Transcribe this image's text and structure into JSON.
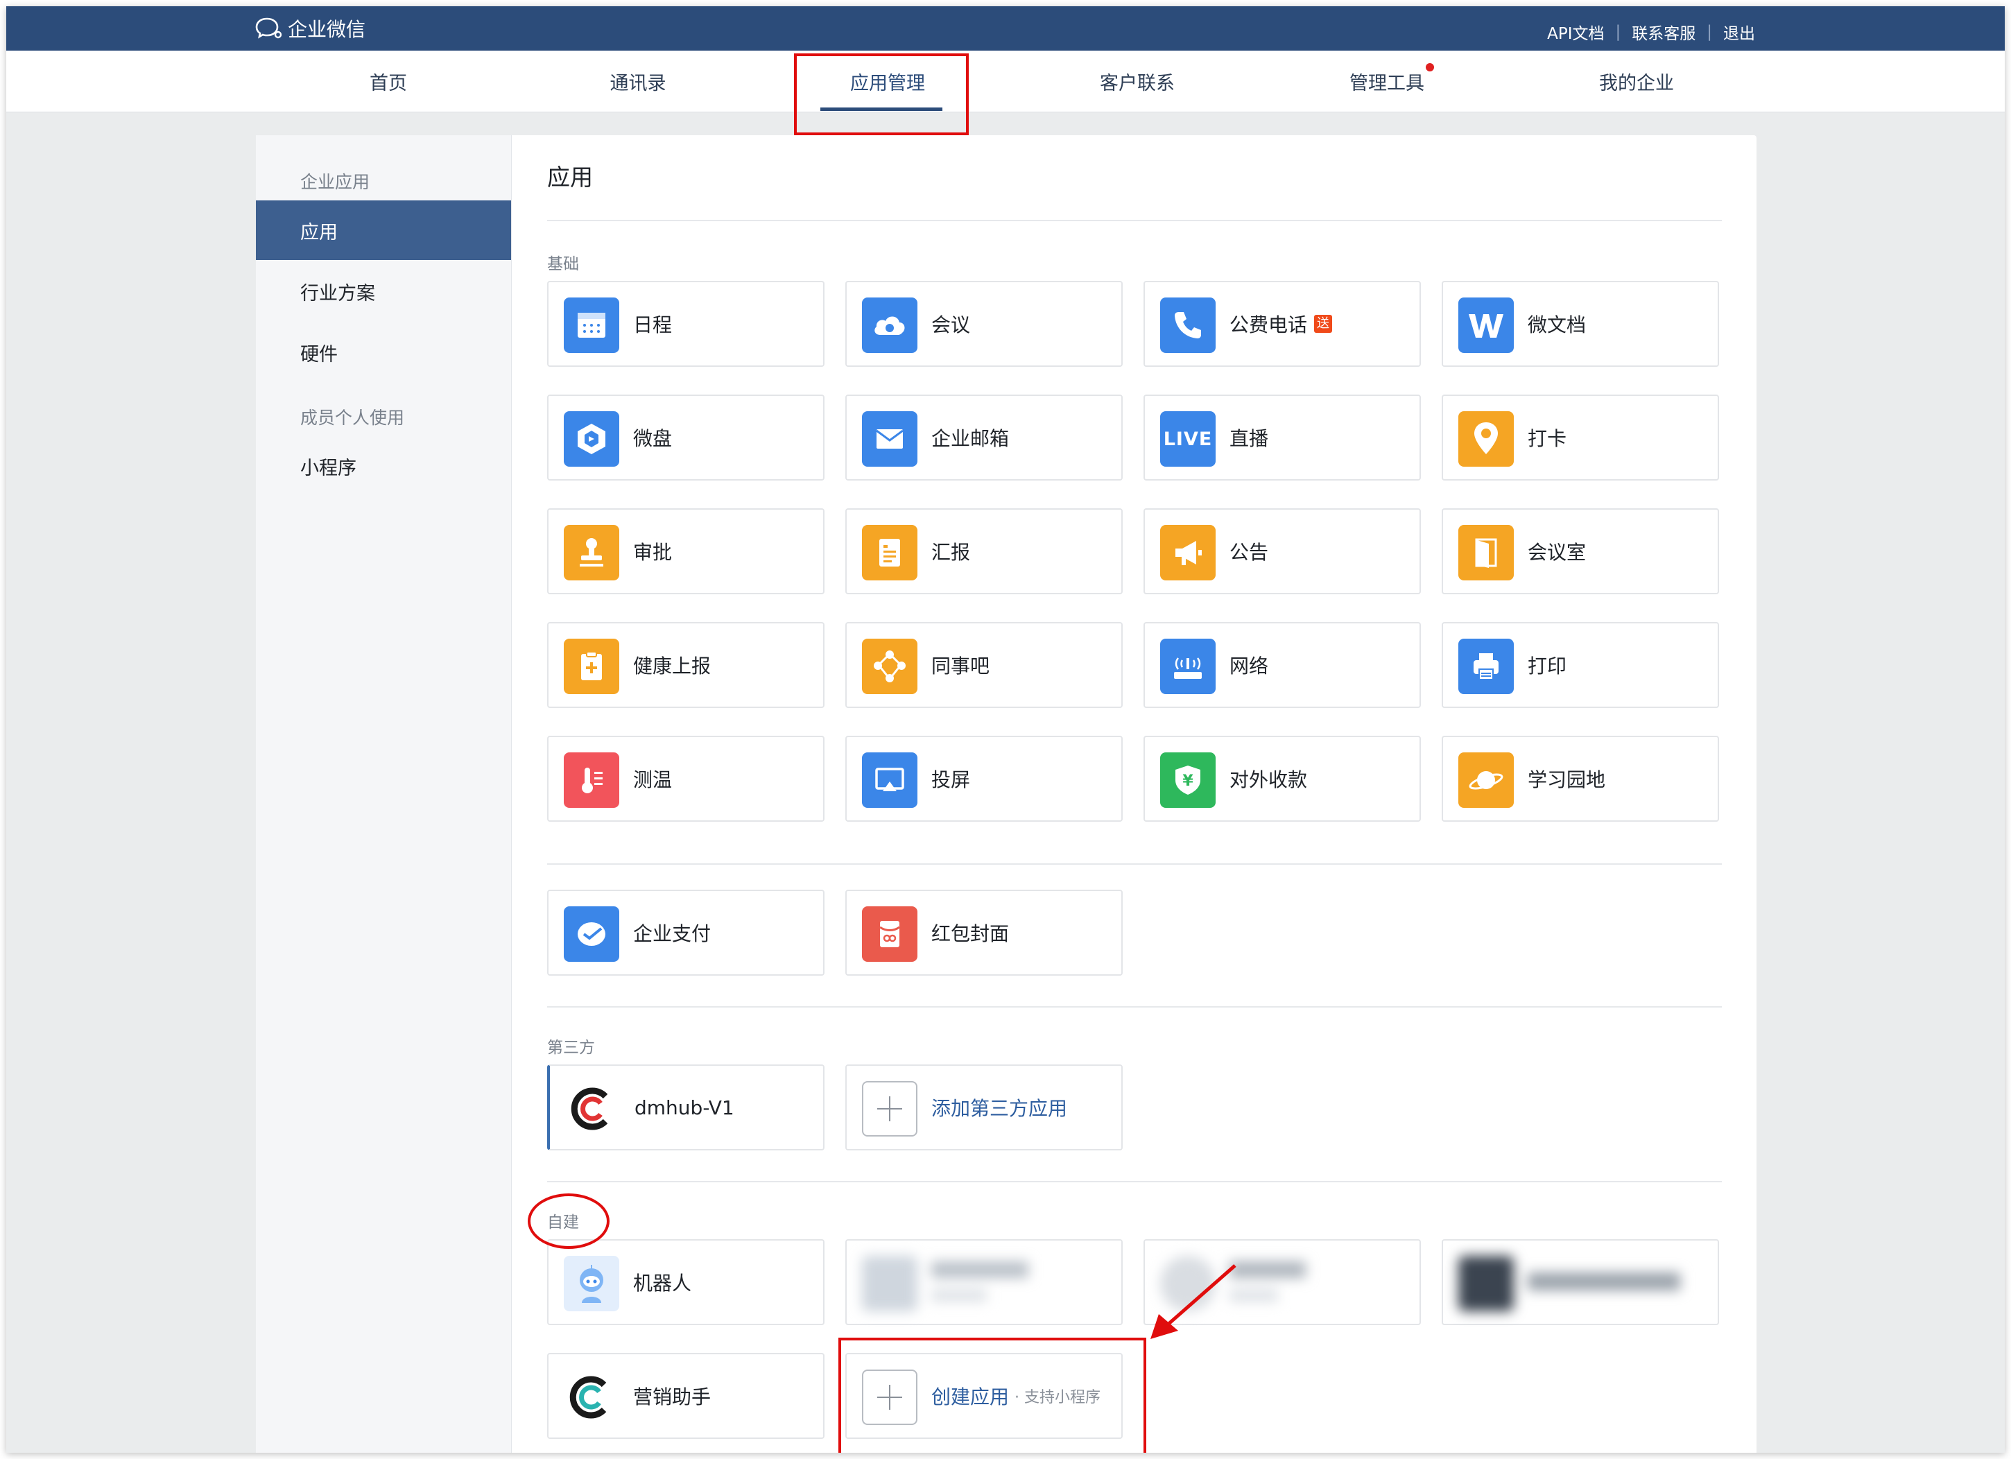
{
  "header": {
    "logo_text": "企业微信",
    "links": [
      "API文档",
      "联系客服",
      "退出"
    ]
  },
  "nav": {
    "tabs": [
      "首页",
      "通讯录",
      "应用管理",
      "客户联系",
      "管理工具",
      "我的企业"
    ],
    "active": "应用管理"
  },
  "sidebar": {
    "section1": "企业应用",
    "items1": [
      "应用",
      "行业方案",
      "硬件"
    ],
    "section2": "成员个人使用",
    "items2": [
      "小程序"
    ]
  },
  "main": {
    "title": "应用",
    "basic_label": "基础",
    "basic_apps": [
      {
        "name": "日程",
        "icon": "calendar-icon",
        "color": "#3b86e8"
      },
      {
        "name": "会议",
        "icon": "cloud-meeting-icon",
        "color": "#3b86e8"
      },
      {
        "name": "公费电话",
        "icon": "phone-icon",
        "color": "#3b86e8",
        "badge": "送"
      },
      {
        "name": "微文档",
        "icon": "doc-w-icon",
        "color": "#3b86e8"
      },
      {
        "name": "微盘",
        "icon": "drive-icon",
        "color": "#3b86e8"
      },
      {
        "name": "企业邮箱",
        "icon": "mail-icon",
        "color": "#3b86e8"
      },
      {
        "name": "直播",
        "icon": "live-icon",
        "color": "#3b86e8",
        "icon_text": "LIVE"
      },
      {
        "name": "打卡",
        "icon": "location-pin-icon",
        "color": "#f5a524"
      },
      {
        "name": "审批",
        "icon": "stamp-icon",
        "color": "#f5a524"
      },
      {
        "name": "汇报",
        "icon": "report-icon",
        "color": "#f5a524"
      },
      {
        "name": "公告",
        "icon": "megaphone-icon",
        "color": "#f5a524"
      },
      {
        "name": "会议室",
        "icon": "door-icon",
        "color": "#f5a524"
      },
      {
        "name": "健康上报",
        "icon": "health-report-icon",
        "color": "#f5a524"
      },
      {
        "name": "同事吧",
        "icon": "community-icon",
        "color": "#f5a524"
      },
      {
        "name": "网络",
        "icon": "router-icon",
        "color": "#3b86e8"
      },
      {
        "name": "打印",
        "icon": "printer-icon",
        "color": "#3b86e8"
      },
      {
        "name": "测温",
        "icon": "thermometer-icon",
        "color": "#f2545b"
      },
      {
        "name": "投屏",
        "icon": "screen-cast-icon",
        "color": "#3b86e8"
      },
      {
        "name": "对外收款",
        "icon": "payment-shield-icon",
        "color": "#2eb85c"
      },
      {
        "name": "学习园地",
        "icon": "planet-icon",
        "color": "#f5a524"
      }
    ],
    "pay_apps": [
      {
        "name": "企业支付",
        "icon": "enterprise-pay-icon",
        "color": "#3b86e8"
      },
      {
        "name": "红包封面",
        "icon": "red-packet-icon",
        "color": "#ea5a4c"
      }
    ],
    "third_party_label": "第三方",
    "third_party_apps": [
      {
        "name": "dmhub-V1",
        "icon": "dmhub-logo-icon"
      }
    ],
    "add_third_party": "添加第三方应用",
    "custom_label": "自建",
    "custom_apps": [
      {
        "name": "机器人",
        "icon": "robot-icon"
      },
      {
        "name": "营销助手",
        "icon": "marketing-logo-icon"
      }
    ],
    "create_app": "创建应用",
    "create_app_sub": "· 支持小程序"
  }
}
